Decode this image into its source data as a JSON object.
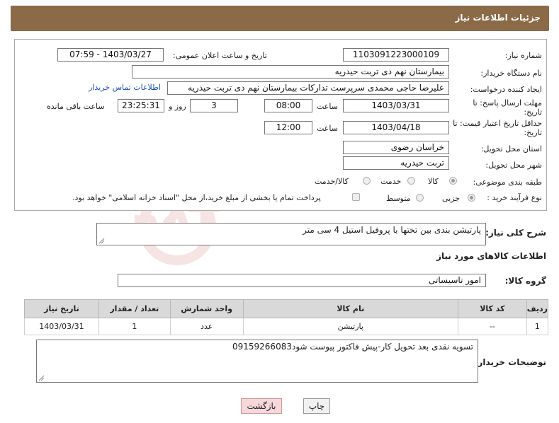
{
  "header": {
    "title": "جزئیات اطلاعات نیاز"
  },
  "form": {
    "need_number": {
      "label": "شماره نیاز:",
      "value": "1103091223000109"
    },
    "announce_datetime": {
      "label": "تاریخ و ساعت اعلان عمومی:",
      "value": "1403/03/27 - 07:59"
    },
    "buyer_org": {
      "label": "نام دستگاه خریدار:",
      "value": "بیمارستان نهم دی تربت حیدریه"
    },
    "requester": {
      "label": "ایجاد کننده درخواست:",
      "value": "علیرضا حاجی محمدی سرپرست تدارکات بیمارستان نهم دی تربت حیدریه",
      "contact_link": "اطلاعات تماس خریدار"
    },
    "reply_deadline": {
      "label_line1": "مهلت ارسال پاسخ: تا",
      "label_line2": "تاریخ:",
      "date": "1403/03/31",
      "time_label": "ساعت",
      "time": "08:00",
      "days": "3",
      "days_label": "روز و",
      "remaining": "23:25:31",
      "remaining_label": "ساعت باقی مانده"
    },
    "price_validity": {
      "label_line1": "حداقل تاریخ اعتبار قیمت: تا",
      "label_line2": "تاریخ:",
      "date": "1403/04/18",
      "time_label": "ساعت",
      "time": "12:00"
    },
    "delivery_province": {
      "label": "استان محل تحویل:",
      "value": "خراسان رضوی"
    },
    "delivery_city": {
      "label": "شهر محل تحویل:",
      "value": "تربت حیدریه"
    },
    "category": {
      "label": "طبقه بندی موضوعی:",
      "options": [
        "کالا",
        "خدمت",
        "کالا/خدمت"
      ],
      "selected": "کالا"
    },
    "process_type": {
      "label": "نوع فرآیند خرید :",
      "options": [
        "جزیی",
        "متوسط"
      ],
      "selected": "جزیی",
      "note": "پرداخت تمام یا بخشی از مبلغ خرید،از محل \"اسناد خزانه اسلامی\" خواهد بود."
    }
  },
  "description": {
    "label": "شرح کلی نیاز:",
    "value": "پارتیشن بندی بین تختها با پروفیل استیل 4 سی متر"
  },
  "goods_section": {
    "title": "اطلاعات کالاهای مورد نیاز",
    "group_label": "گروه کالا:",
    "group_value": "امور تاسیساتی"
  },
  "table": {
    "headers": [
      "ردیف",
      "کد کالا",
      "نام کالا",
      "واحد شمارش",
      "تعداد / مقدار",
      "تاریخ نیاز"
    ],
    "rows": [
      [
        "1",
        "--",
        "پارتیشن",
        "عدد",
        "1",
        "1403/03/31"
      ]
    ]
  },
  "buyer_notes": {
    "label": "توضیحات خریدار:",
    "value": "تسویه نقدی بعد تحویل کار-پیش فاکتور پیوست شود09159266083"
  },
  "buttons": {
    "print": "چاپ",
    "back": "بازگشت"
  },
  "watermark": {
    "text": "AriaTender.neT",
    "color": "#c0392b"
  }
}
